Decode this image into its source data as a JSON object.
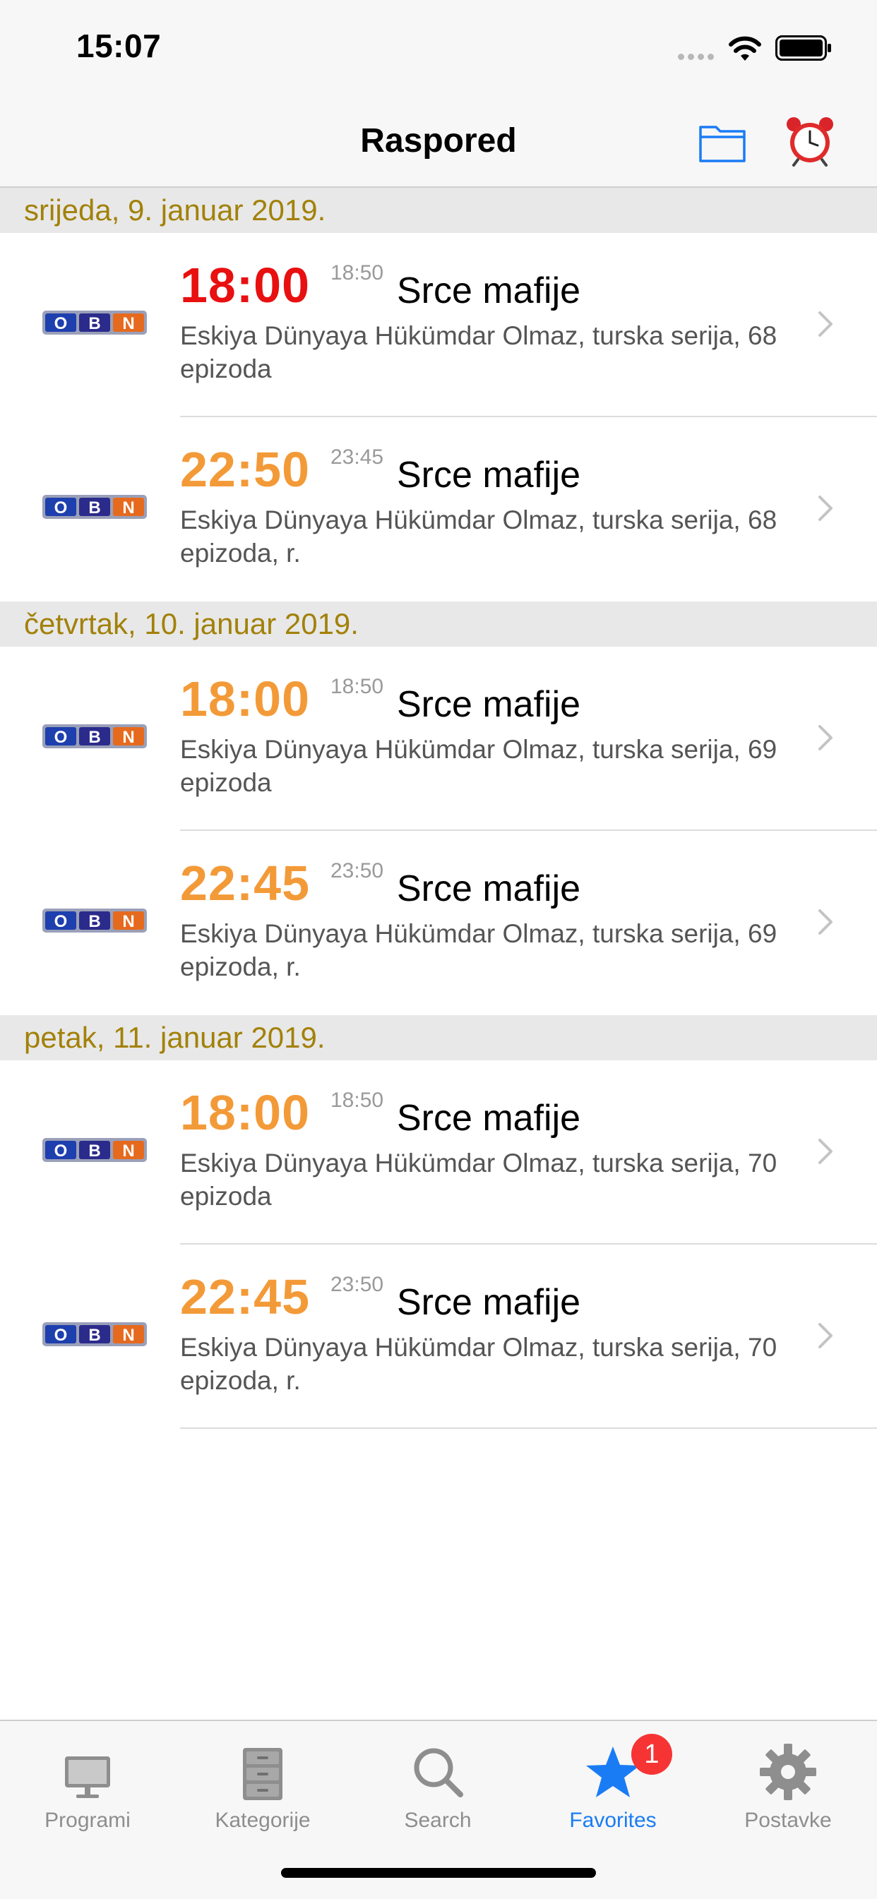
{
  "status": {
    "time": "15:07"
  },
  "nav": {
    "title": "Raspored"
  },
  "colors": {
    "accent": "#1a7cf5",
    "section_text": "#a28109",
    "time_orange": "#f39a38",
    "time_live": "#e81010"
  },
  "sections": [
    {
      "date": "srijeda, 9. januar 2019.",
      "items": [
        {
          "channel": "OBN",
          "start": "18:00",
          "end": "18:50",
          "title": "Srce mafije",
          "desc": "Eskiya Dünyaya Hükümdar Olmaz, turska serija, 68 epizoda",
          "live": true
        },
        {
          "channel": "OBN",
          "start": "22:50",
          "end": "23:45",
          "title": "Srce mafije",
          "desc": "Eskiya Dünyaya Hükümdar Olmaz, turska serija, 68 epizoda, r.",
          "live": false
        }
      ]
    },
    {
      "date": "četvrtak, 10. januar 2019.",
      "items": [
        {
          "channel": "OBN",
          "start": "18:00",
          "end": "18:50",
          "title": "Srce mafije",
          "desc": "Eskiya Dünyaya Hükümdar Olmaz, turska serija, 69 epizoda",
          "live": false
        },
        {
          "channel": "OBN",
          "start": "22:45",
          "end": "23:50",
          "title": "Srce mafije",
          "desc": "Eskiya Dünyaya Hükümdar Olmaz, turska serija, 69 epizoda, r.",
          "live": false
        }
      ]
    },
    {
      "date": "petak, 11. januar 2019.",
      "items": [
        {
          "channel": "OBN",
          "start": "18:00",
          "end": "18:50",
          "title": "Srce mafije",
          "desc": "Eskiya Dünyaya Hükümdar Olmaz, turska serija, 70 epizoda",
          "live": false
        },
        {
          "channel": "OBN",
          "start": "22:45",
          "end": "23:50",
          "title": "Srce mafije",
          "desc": "Eskiya Dünyaya Hükümdar Olmaz, turska serija, 70 epizoda, r.",
          "live": false
        }
      ]
    }
  ],
  "tabs": [
    {
      "label": "Programi",
      "icon": "monitor-icon"
    },
    {
      "label": "Kategorije",
      "icon": "cabinet-icon"
    },
    {
      "label": "Search",
      "icon": "search-icon"
    },
    {
      "label": "Favorites",
      "icon": "star-icon",
      "badge": "1",
      "active": true
    },
    {
      "label": "Postavke",
      "icon": "gear-icon"
    }
  ]
}
